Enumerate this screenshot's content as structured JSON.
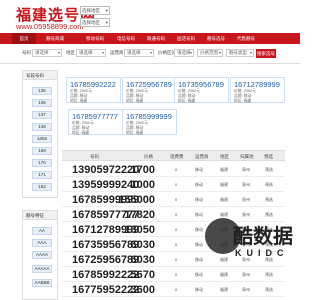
{
  "header": {
    "title": "福建选号网",
    "url": "www.05958899.com",
    "select1": "选择地区",
    "select2": "选择地区"
  },
  "nav": [
    "首页",
    "靓号商城",
    "移动号码",
    "电信号码",
    "联通号码",
    "固话号码",
    "靓号选号",
    "代售靓号"
  ],
  "filter": {
    "label1": "号码",
    "select1": "请选择",
    "label2": "地区",
    "select2": "请选择",
    "label3": "运营商",
    "select3": "请选择",
    "label4": "价格区间",
    "select4": "请选择",
    "select5": "价格范围",
    "select6": "靓号类型",
    "search": "搜索选号"
  },
  "sidebar": {
    "box1_title": "号段号码",
    "box1_items": [
      "135",
      "136",
      "137",
      "138",
      "1655",
      "169",
      "170",
      "171",
      "162"
    ],
    "box2_title": "靓号特征",
    "box2_items": [
      "AA",
      "AAA",
      "AAAA",
      "AAAAA",
      "AABBB"
    ]
  },
  "cards": [
    {
      "num": "16785992222",
      "line1": "价格: 2000元",
      "line2": "品牌: 移动",
      "line3": "地区: 福建"
    },
    {
      "num": "16725956789",
      "line1": "价格: 2000元",
      "line2": "品牌: 移动",
      "line3": "地区: 福建"
    },
    {
      "num": "16735956789",
      "line1": "价格: 2000元",
      "line2": "品牌: 移动",
      "line3": "地区: 福建"
    },
    {
      "num": "16712789999",
      "line1": "价格: 2000元",
      "line2": "品牌: 移动",
      "line3": "地区: 福建"
    },
    {
      "num": "16785977777",
      "line1": "价格: 2000元",
      "line2": "品牌: 移动",
      "line3": "地区: 福建"
    },
    {
      "num": "16785999999",
      "line1": "价格: 2000元",
      "line2": "品牌: 移动",
      "line3": "地区: 福建"
    }
  ],
  "table": {
    "headers": [
      "号码",
      "价格",
      "话费费",
      "运营商",
      "地区",
      "归属地",
      "预选"
    ],
    "rows": [
      {
        "num": "13905972220",
        "price": "1700",
        "fee": "0",
        "carrier": "移动",
        "region": "福建",
        "loc": "泉州",
        "pick": "预选"
      },
      {
        "num": "13959999240",
        "price": "1000",
        "fee": "0",
        "carrier": "移动",
        "region": "福建",
        "loc": "泉州",
        "pick": "预选"
      },
      {
        "num": "16785999999",
        "price": "155000",
        "fee": "0",
        "carrier": "移动",
        "region": "福建",
        "loc": "泉州",
        "pick": "预选"
      },
      {
        "num": "16785977777",
        "price": "17820",
        "fee": "0",
        "carrier": "移动",
        "region": "福建",
        "loc": "泉州",
        "pick": "预选"
      },
      {
        "num": "16712789999",
        "price": "13050",
        "fee": "0",
        "carrier": "移动",
        "region": "福建",
        "loc": "泉州",
        "pick": "预选"
      },
      {
        "num": "16735956789",
        "price": "6030",
        "fee": "0",
        "carrier": "移动",
        "region": "福建",
        "loc": "泉州",
        "pick": "预选"
      },
      {
        "num": "16725956789",
        "price": "6030",
        "fee": "0",
        "carrier": "移动",
        "region": "福建",
        "loc": "泉州",
        "pick": "预选"
      },
      {
        "num": "16785992222",
        "price": "5670",
        "fee": "0",
        "carrier": "移动",
        "region": "福建",
        "loc": "泉州",
        "pick": "预选"
      },
      {
        "num": "16775952222",
        "price": "3600",
        "fee": "0",
        "carrier": "移动",
        "region": "福建",
        "loc": "泉州",
        "pick": "预选"
      }
    ]
  },
  "watermark": {
    "cn": "酷数据",
    "en": "KUIDC"
  },
  "colors": {
    "brand": "#c8161d",
    "card_number": "#1f5fa8"
  }
}
